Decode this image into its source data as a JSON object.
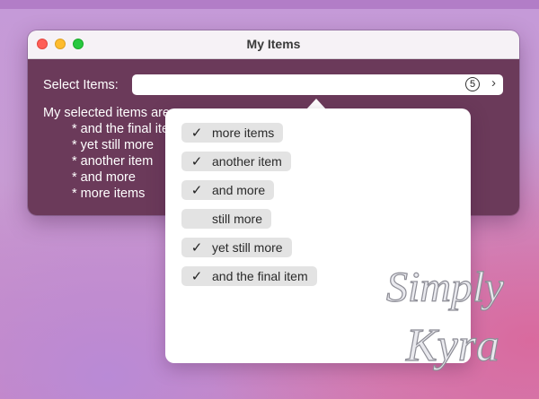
{
  "window": {
    "title": "My Items"
  },
  "picker": {
    "label": "Select Items:",
    "count": "5",
    "chevron": "›"
  },
  "summary": {
    "title": "My selected items are:",
    "lines": [
      "* and the final item",
      "* yet still more",
      "* another item",
      "* and more",
      "* more items"
    ]
  },
  "options": [
    {
      "label": "more items",
      "checked": true,
      "mark": "✓"
    },
    {
      "label": "another item",
      "checked": true,
      "mark": "✓"
    },
    {
      "label": "and more",
      "checked": true,
      "mark": "✓"
    },
    {
      "label": "still more",
      "checked": false,
      "mark": ""
    },
    {
      "label": "yet still more",
      "checked": true,
      "mark": "✓"
    },
    {
      "label": "and the final item",
      "checked": true,
      "mark": "✓"
    }
  ],
  "watermark": {
    "line1": "Simply",
    "line2": "Kyra"
  },
  "colors": {
    "close": "#ff5f57",
    "minimize": "#febc2e",
    "maximize": "#28c840",
    "content_bg": "#6b3a5a",
    "chip_bg": "#e3e3e3"
  }
}
